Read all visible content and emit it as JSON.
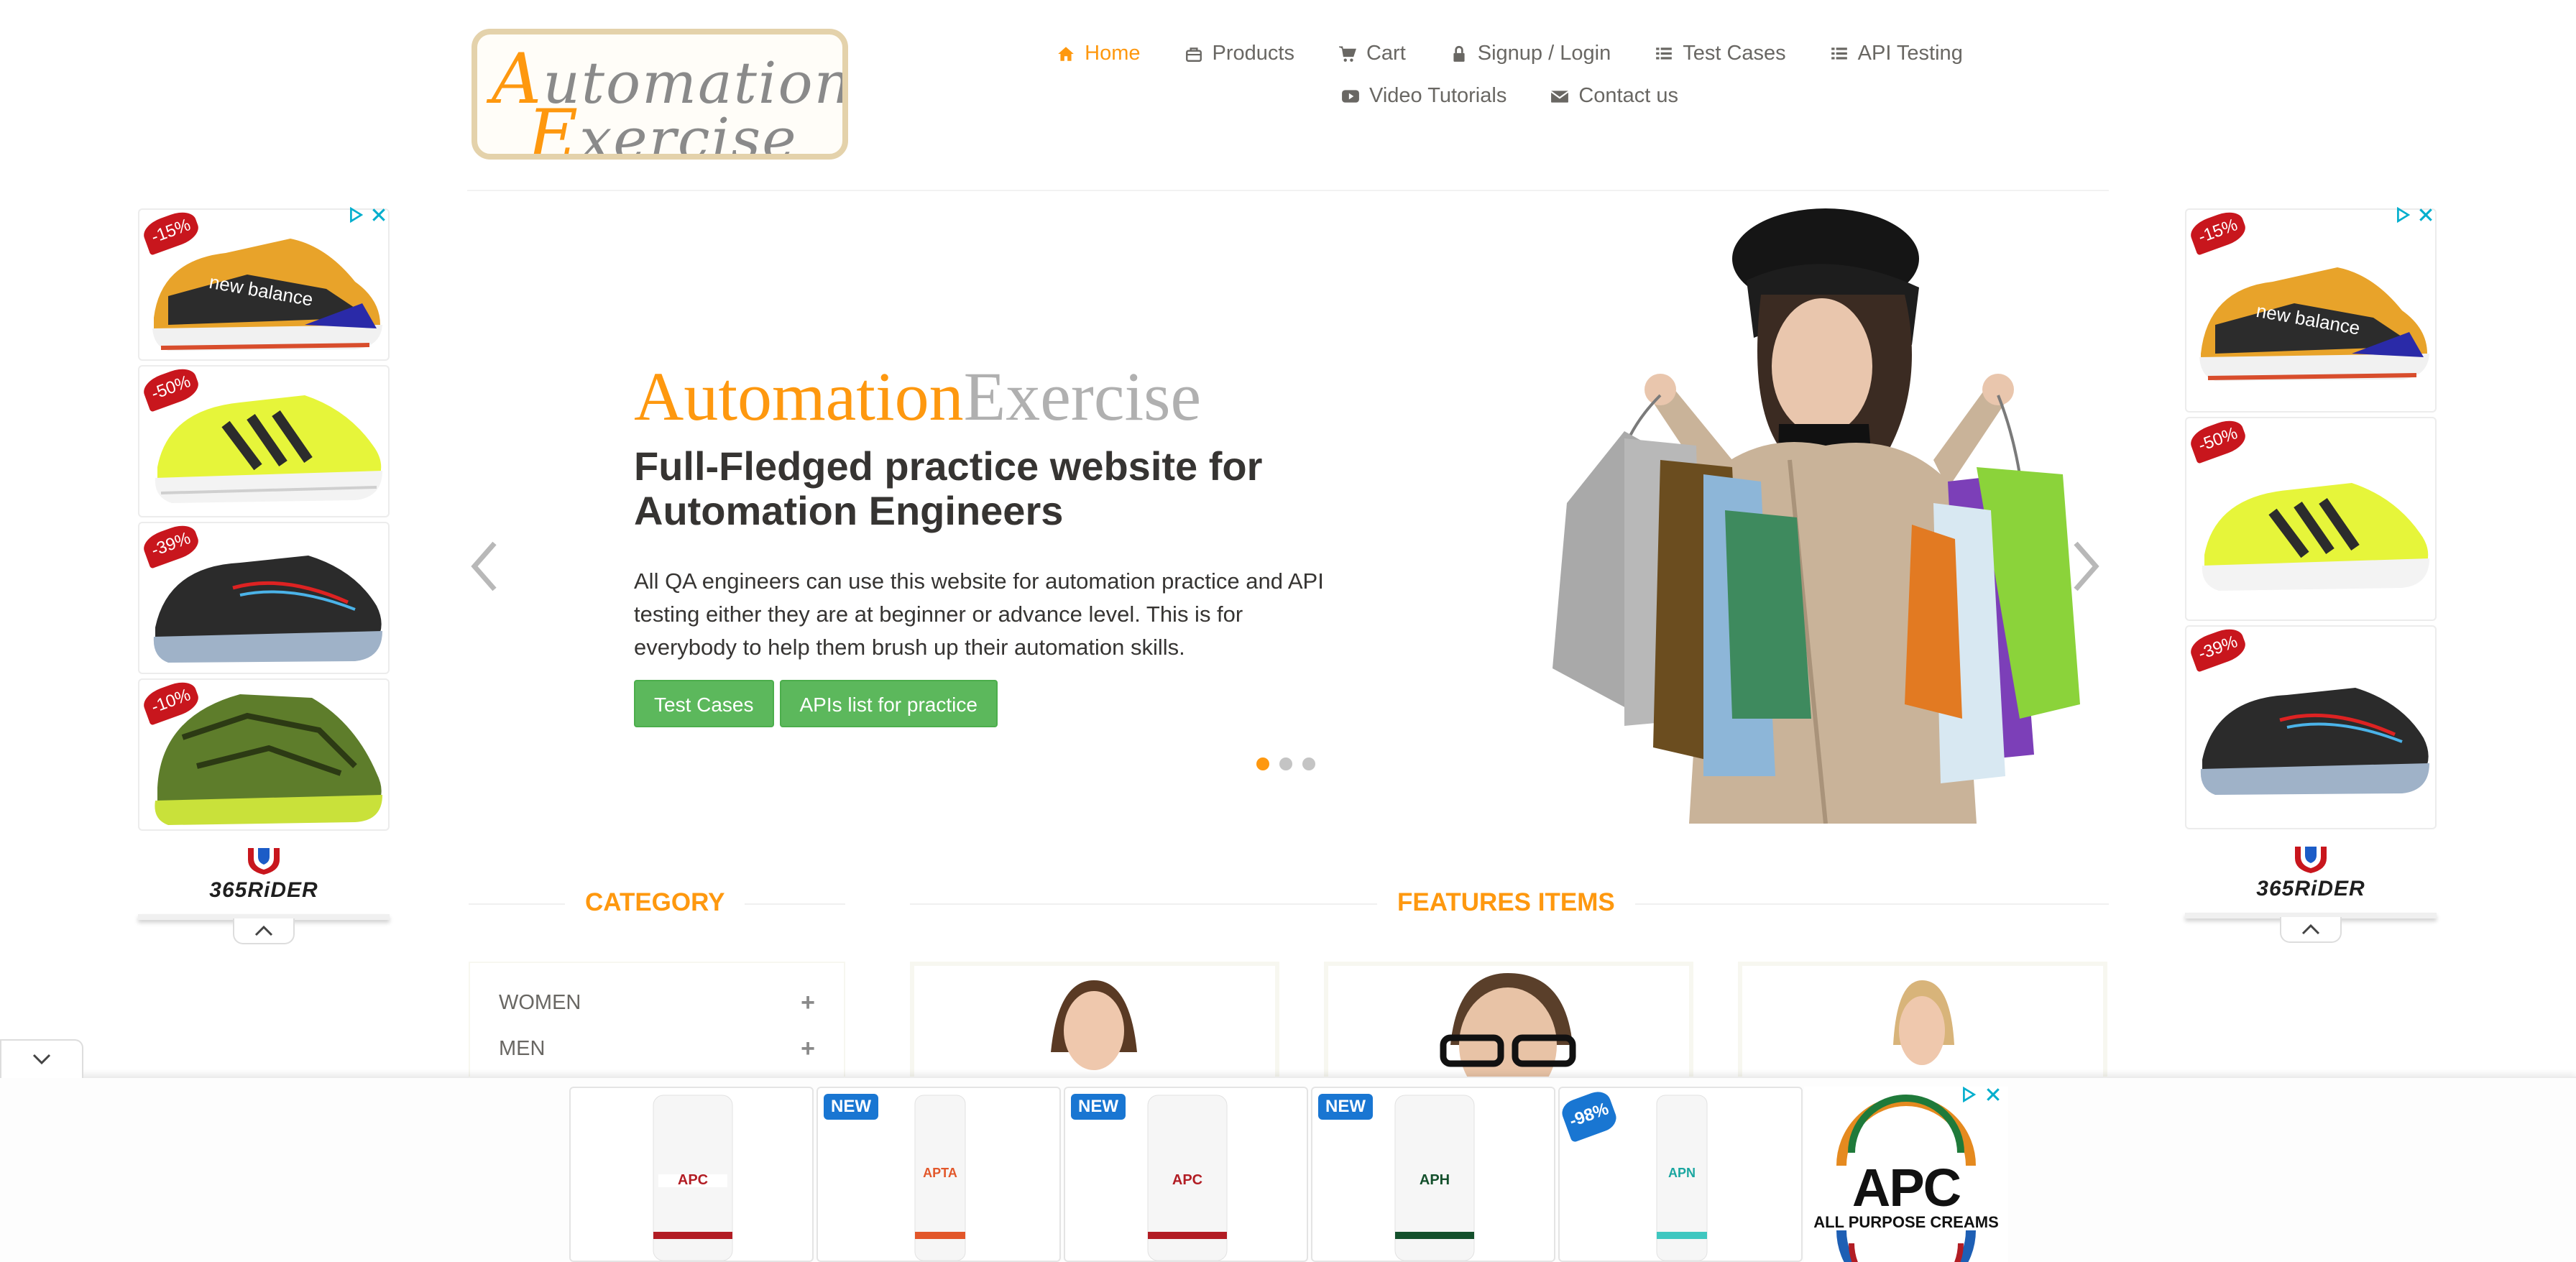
{
  "header": {
    "logo": {
      "line1": "Automation",
      "line2": "Exercise"
    },
    "nav": [
      {
        "label": "Home",
        "icon": "home-icon",
        "active": true
      },
      {
        "label": "Products",
        "icon": "products-icon",
        "active": false
      },
      {
        "label": "Cart",
        "icon": "cart-icon",
        "active": false
      },
      {
        "label": "Signup / Login",
        "icon": "lock-icon",
        "active": false
      },
      {
        "label": "Test Cases",
        "icon": "list-icon",
        "active": false
      },
      {
        "label": "API Testing",
        "icon": "list-icon",
        "active": false
      },
      {
        "label": "Video Tutorials",
        "icon": "youtube-icon",
        "active": false
      },
      {
        "label": "Contact us",
        "icon": "envelope-icon",
        "active": false
      }
    ]
  },
  "slider": {
    "brand_part1": "Automation",
    "brand_part2": "Exercise",
    "heading": "Full-Fledged practice website for Automation Engineers",
    "text": "All QA engineers can use this website for automation practice and API testing either they are at beginner or advance level. This is for everybody to help them brush up their automation skills.",
    "buttons": [
      "Test Cases",
      "APIs list for practice"
    ],
    "active_slide": 1,
    "slide_count": 3
  },
  "category": {
    "title": "CATEGORY",
    "items": [
      "WOMEN",
      "MEN"
    ]
  },
  "features": {
    "title": "FEATURES ITEMS"
  },
  "side_ads": {
    "left_tags": [
      "-15%",
      "-50%",
      "-39%",
      "-10%"
    ],
    "right_tags": [
      "-15%",
      "-50%",
      "-39%"
    ],
    "brand": "365RiDER"
  },
  "bottom_ad": {
    "badges": [
      "",
      "NEW",
      "NEW",
      "NEW",
      "-98%"
    ],
    "brand_name": "APC",
    "brand_sub": "ALL PURPOSE CREAMS"
  },
  "colors": {
    "accent": "#fe980f",
    "button": "#5cb85c",
    "sale_tag": "#c8161d",
    "ad_badge": "#1976d2"
  }
}
